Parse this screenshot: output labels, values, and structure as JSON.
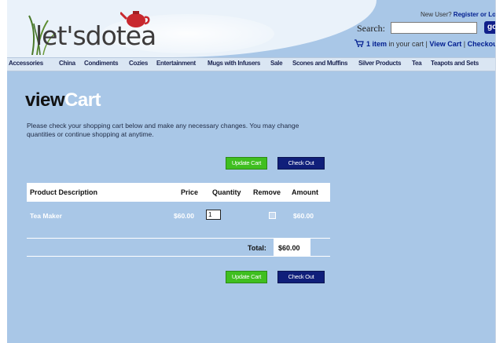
{
  "header": {
    "logo_text": "let'sdotea",
    "new_user_text": "New User? ",
    "register_link": "Register or Log I",
    "search_label": "Search:",
    "search_value": "",
    "go_label": "go",
    "cart_count": "1 item",
    "cart_text": " in your cart | ",
    "view_cart_link": "View Cart",
    "separator": " | ",
    "checkout_link": "Checkou"
  },
  "nav": {
    "items": [
      "Accessories",
      "China",
      "Condiments",
      "Cozies",
      "Entertainment",
      "Mugs with Infusers",
      "Sale",
      "Scones and Muffins",
      "Silver Products",
      "Tea",
      "Teapots and Sets"
    ]
  },
  "content": {
    "title_view": "view",
    "title_cart": "Cart",
    "intro": "Please check your shopping cart below and make any necessary changes. You may change quantities or continue shopping at anytime.",
    "update_cart_label": "Update Cart",
    "check_out_label": "Check Out"
  },
  "table": {
    "headers": [
      "Product Description",
      "Price",
      "Quantity",
      "Remove",
      "Amount"
    ],
    "rows": [
      {
        "product": "Tea Maker",
        "price": "$60.00",
        "quantity": "1",
        "amount": "$60.00"
      }
    ],
    "total_label": "Total:",
    "total_value": "$60.00"
  },
  "colors": {
    "background": "#a9c7e7",
    "update_button": "#3fbf20",
    "checkout_button": "#101f7a",
    "link": "#001d8f"
  },
  "icons": [
    "cart-icon",
    "teapot-icon"
  ]
}
